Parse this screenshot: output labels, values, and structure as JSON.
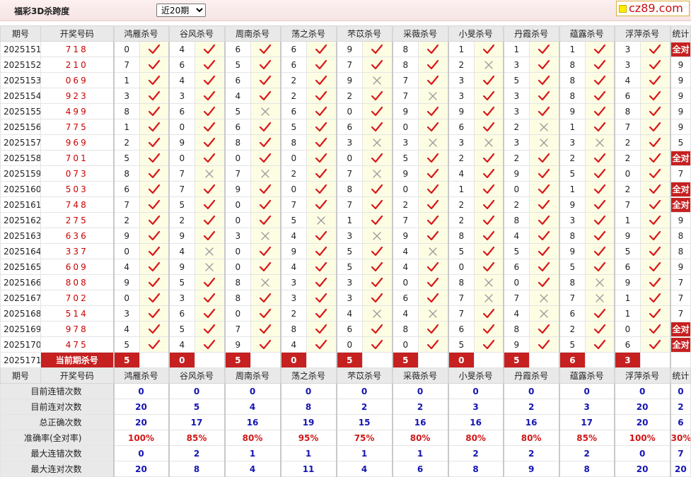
{
  "header": {
    "title": "福彩3D杀跨度",
    "period_selected": "近20期",
    "logo_text": "cz89.com"
  },
  "columns": {
    "issue": "期号",
    "number": "开奖号码",
    "experts": [
      "鸿雁杀号",
      "谷风杀号",
      "周南杀号",
      "荡之杀号",
      "芣苡杀号",
      "采薇杀号",
      "小旻杀号",
      "丹霞杀号",
      "蕴露杀号",
      "浮萍杀号"
    ],
    "stats": "统计"
  },
  "labels": {
    "all_correct": "全对",
    "current_kill": "当前期杀号"
  },
  "rows": [
    {
      "issue": "2025151",
      "number": "718",
      "cells": [
        [
          "0",
          "y"
        ],
        [
          "4",
          "y"
        ],
        [
          "6",
          "y"
        ],
        [
          "6",
          "y"
        ],
        [
          "9",
          "y"
        ],
        [
          "8",
          "y"
        ],
        [
          "1",
          "y"
        ],
        [
          "1",
          "y"
        ],
        [
          "1",
          "y"
        ],
        [
          "3",
          "y"
        ]
      ],
      "stat": "全对"
    },
    {
      "issue": "2025152",
      "number": "210",
      "cells": [
        [
          "7",
          "y"
        ],
        [
          "6",
          "y"
        ],
        [
          "5",
          "y"
        ],
        [
          "6",
          "y"
        ],
        [
          "7",
          "y"
        ],
        [
          "8",
          "y"
        ],
        [
          "2",
          "n"
        ],
        [
          "3",
          "y"
        ],
        [
          "8",
          "y"
        ],
        [
          "3",
          "y"
        ]
      ],
      "stat": "9"
    },
    {
      "issue": "2025153",
      "number": "069",
      "cells": [
        [
          "1",
          "y"
        ],
        [
          "4",
          "y"
        ],
        [
          "6",
          "y"
        ],
        [
          "2",
          "y"
        ],
        [
          "9",
          "n"
        ],
        [
          "7",
          "y"
        ],
        [
          "3",
          "y"
        ],
        [
          "5",
          "y"
        ],
        [
          "8",
          "y"
        ],
        [
          "4",
          "y"
        ]
      ],
      "stat": "9"
    },
    {
      "issue": "2025154",
      "number": "923",
      "cells": [
        [
          "3",
          "y"
        ],
        [
          "3",
          "y"
        ],
        [
          "4",
          "y"
        ],
        [
          "2",
          "y"
        ],
        [
          "2",
          "y"
        ],
        [
          "7",
          "n"
        ],
        [
          "3",
          "y"
        ],
        [
          "3",
          "y"
        ],
        [
          "8",
          "y"
        ],
        [
          "6",
          "y"
        ]
      ],
      "stat": "9"
    },
    {
      "issue": "2025155",
      "number": "499",
      "cells": [
        [
          "8",
          "y"
        ],
        [
          "6",
          "y"
        ],
        [
          "5",
          "n"
        ],
        [
          "6",
          "y"
        ],
        [
          "0",
          "y"
        ],
        [
          "9",
          "y"
        ],
        [
          "9",
          "y"
        ],
        [
          "3",
          "y"
        ],
        [
          "9",
          "y"
        ],
        [
          "8",
          "y"
        ]
      ],
      "stat": "9"
    },
    {
      "issue": "2025156",
      "number": "775",
      "cells": [
        [
          "1",
          "y"
        ],
        [
          "0",
          "y"
        ],
        [
          "6",
          "y"
        ],
        [
          "5",
          "y"
        ],
        [
          "6",
          "y"
        ],
        [
          "0",
          "y"
        ],
        [
          "6",
          "y"
        ],
        [
          "2",
          "n"
        ],
        [
          "1",
          "y"
        ],
        [
          "7",
          "y"
        ]
      ],
      "stat": "9"
    },
    {
      "issue": "2025157",
      "number": "969",
      "cells": [
        [
          "2",
          "y"
        ],
        [
          "9",
          "y"
        ],
        [
          "8",
          "y"
        ],
        [
          "8",
          "y"
        ],
        [
          "3",
          "n"
        ],
        [
          "3",
          "n"
        ],
        [
          "3",
          "n"
        ],
        [
          "3",
          "n"
        ],
        [
          "3",
          "n"
        ],
        [
          "2",
          "y"
        ]
      ],
      "stat": "5"
    },
    {
      "issue": "2025158",
      "number": "701",
      "cells": [
        [
          "5",
          "y"
        ],
        [
          "0",
          "y"
        ],
        [
          "0",
          "y"
        ],
        [
          "0",
          "y"
        ],
        [
          "0",
          "y"
        ],
        [
          "5",
          "y"
        ],
        [
          "2",
          "y"
        ],
        [
          "2",
          "y"
        ],
        [
          "2",
          "y"
        ],
        [
          "2",
          "y"
        ]
      ],
      "stat": "全对"
    },
    {
      "issue": "2025159",
      "number": "073",
      "cells": [
        [
          "8",
          "y"
        ],
        [
          "7",
          "n"
        ],
        [
          "7",
          "n"
        ],
        [
          "2",
          "y"
        ],
        [
          "7",
          "n"
        ],
        [
          "9",
          "y"
        ],
        [
          "4",
          "y"
        ],
        [
          "9",
          "y"
        ],
        [
          "5",
          "y"
        ],
        [
          "0",
          "y"
        ]
      ],
      "stat": "7"
    },
    {
      "issue": "2025160",
      "number": "503",
      "cells": [
        [
          "6",
          "y"
        ],
        [
          "7",
          "y"
        ],
        [
          "9",
          "y"
        ],
        [
          "0",
          "y"
        ],
        [
          "8",
          "y"
        ],
        [
          "0",
          "y"
        ],
        [
          "1",
          "y"
        ],
        [
          "0",
          "y"
        ],
        [
          "1",
          "y"
        ],
        [
          "2",
          "y"
        ]
      ],
      "stat": "全对"
    },
    {
      "issue": "2025161",
      "number": "748",
      "cells": [
        [
          "7",
          "y"
        ],
        [
          "5",
          "y"
        ],
        [
          "0",
          "y"
        ],
        [
          "7",
          "y"
        ],
        [
          "7",
          "y"
        ],
        [
          "2",
          "y"
        ],
        [
          "2",
          "y"
        ],
        [
          "2",
          "y"
        ],
        [
          "9",
          "y"
        ],
        [
          "7",
          "y"
        ]
      ],
      "stat": "全对"
    },
    {
      "issue": "2025162",
      "number": "275",
      "cells": [
        [
          "2",
          "y"
        ],
        [
          "2",
          "y"
        ],
        [
          "0",
          "y"
        ],
        [
          "5",
          "n"
        ],
        [
          "1",
          "y"
        ],
        [
          "7",
          "y"
        ],
        [
          "2",
          "y"
        ],
        [
          "8",
          "y"
        ],
        [
          "3",
          "y"
        ],
        [
          "1",
          "y"
        ]
      ],
      "stat": "9"
    },
    {
      "issue": "2025163",
      "number": "636",
      "cells": [
        [
          "9",
          "y"
        ],
        [
          "9",
          "y"
        ],
        [
          "3",
          "n"
        ],
        [
          "4",
          "y"
        ],
        [
          "3",
          "n"
        ],
        [
          "9",
          "y"
        ],
        [
          "8",
          "y"
        ],
        [
          "4",
          "y"
        ],
        [
          "8",
          "y"
        ],
        [
          "9",
          "y"
        ]
      ],
      "stat": "8"
    },
    {
      "issue": "2025164",
      "number": "337",
      "cells": [
        [
          "0",
          "y"
        ],
        [
          "4",
          "n"
        ],
        [
          "0",
          "y"
        ],
        [
          "9",
          "y"
        ],
        [
          "5",
          "y"
        ],
        [
          "4",
          "n"
        ],
        [
          "5",
          "y"
        ],
        [
          "5",
          "y"
        ],
        [
          "9",
          "y"
        ],
        [
          "5",
          "y"
        ]
      ],
      "stat": "8"
    },
    {
      "issue": "2025165",
      "number": "609",
      "cells": [
        [
          "4",
          "y"
        ],
        [
          "9",
          "n"
        ],
        [
          "0",
          "y"
        ],
        [
          "4",
          "y"
        ],
        [
          "5",
          "y"
        ],
        [
          "4",
          "y"
        ],
        [
          "0",
          "y"
        ],
        [
          "6",
          "y"
        ],
        [
          "5",
          "y"
        ],
        [
          "6",
          "y"
        ]
      ],
      "stat": "9"
    },
    {
      "issue": "2025166",
      "number": "808",
      "cells": [
        [
          "9",
          "y"
        ],
        [
          "5",
          "y"
        ],
        [
          "8",
          "n"
        ],
        [
          "3",
          "y"
        ],
        [
          "3",
          "y"
        ],
        [
          "0",
          "y"
        ],
        [
          "8",
          "n"
        ],
        [
          "0",
          "y"
        ],
        [
          "8",
          "n"
        ],
        [
          "9",
          "y"
        ]
      ],
      "stat": "7"
    },
    {
      "issue": "2025167",
      "number": "702",
      "cells": [
        [
          "0",
          "y"
        ],
        [
          "3",
          "y"
        ],
        [
          "8",
          "y"
        ],
        [
          "3",
          "y"
        ],
        [
          "3",
          "y"
        ],
        [
          "6",
          "y"
        ],
        [
          "7",
          "n"
        ],
        [
          "7",
          "n"
        ],
        [
          "7",
          "n"
        ],
        [
          "1",
          "y"
        ]
      ],
      "stat": "7"
    },
    {
      "issue": "2025168",
      "number": "514",
      "cells": [
        [
          "3",
          "y"
        ],
        [
          "6",
          "y"
        ],
        [
          "0",
          "y"
        ],
        [
          "2",
          "y"
        ],
        [
          "4",
          "n"
        ],
        [
          "4",
          "n"
        ],
        [
          "7",
          "y"
        ],
        [
          "4",
          "n"
        ],
        [
          "6",
          "y"
        ],
        [
          "1",
          "y"
        ]
      ],
      "stat": "7"
    },
    {
      "issue": "2025169",
      "number": "978",
      "cells": [
        [
          "4",
          "y"
        ],
        [
          "5",
          "y"
        ],
        [
          "7",
          "y"
        ],
        [
          "8",
          "y"
        ],
        [
          "6",
          "y"
        ],
        [
          "8",
          "y"
        ],
        [
          "6",
          "y"
        ],
        [
          "8",
          "y"
        ],
        [
          "2",
          "y"
        ],
        [
          "0",
          "y"
        ]
      ],
      "stat": "全对"
    },
    {
      "issue": "2025170",
      "number": "475",
      "cells": [
        [
          "5",
          "y"
        ],
        [
          "4",
          "y"
        ],
        [
          "9",
          "y"
        ],
        [
          "4",
          "y"
        ],
        [
          "0",
          "y"
        ],
        [
          "0",
          "y"
        ],
        [
          "5",
          "y"
        ],
        [
          "9",
          "y"
        ],
        [
          "5",
          "y"
        ],
        [
          "6",
          "y"
        ]
      ],
      "stat": "全对"
    }
  ],
  "current": {
    "issue": "2025171",
    "kills": [
      "5",
      "0",
      "5",
      "0",
      "5",
      "5",
      "0",
      "5",
      "6",
      "3"
    ]
  },
  "stats": [
    {
      "label": "目前连错次数",
      "values": [
        "0",
        "0",
        "0",
        "0",
        "0",
        "0",
        "0",
        "0",
        "0",
        "0"
      ],
      "total": "0",
      "pct": false
    },
    {
      "label": "目前连对次数",
      "values": [
        "20",
        "5",
        "4",
        "8",
        "2",
        "2",
        "3",
        "2",
        "3",
        "20"
      ],
      "total": "2",
      "pct": false
    },
    {
      "label": "总正确次数",
      "values": [
        "20",
        "17",
        "16",
        "19",
        "15",
        "16",
        "16",
        "16",
        "17",
        "20"
      ],
      "total": "6",
      "pct": false
    },
    {
      "label": "准确率(全对率)",
      "values": [
        "100%",
        "85%",
        "80%",
        "95%",
        "75%",
        "80%",
        "80%",
        "80%",
        "85%",
        "100%"
      ],
      "total": "30%",
      "pct": true
    },
    {
      "label": "最大连错次数",
      "values": [
        "0",
        "2",
        "1",
        "1",
        "1",
        "1",
        "2",
        "2",
        "2",
        "0"
      ],
      "total": "7",
      "pct": false
    },
    {
      "label": "最大连对次数",
      "values": [
        "20",
        "8",
        "4",
        "11",
        "4",
        "6",
        "8",
        "9",
        "8",
        "20"
      ],
      "total": "20",
      "pct": false
    }
  ]
}
